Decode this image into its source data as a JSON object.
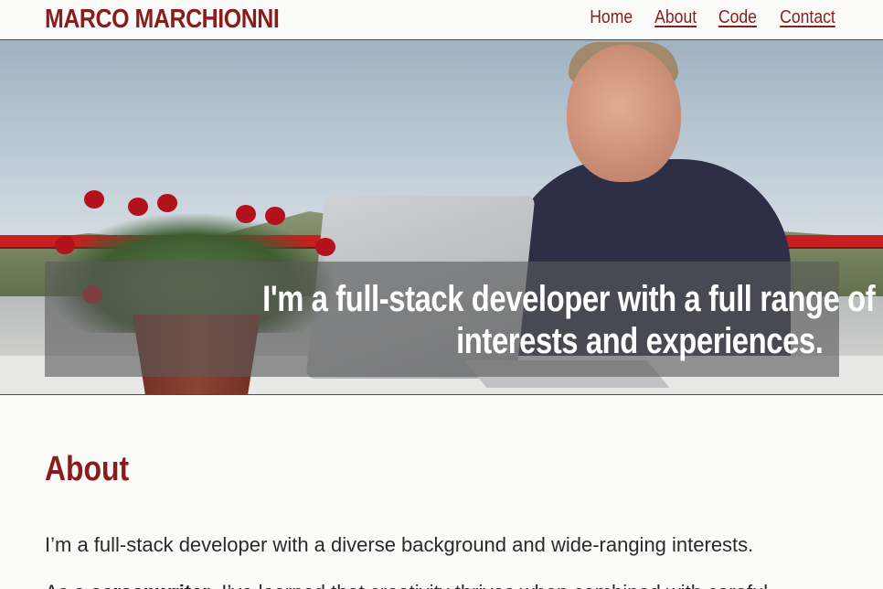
{
  "header": {
    "brand": "MARCO MARCHIONNI",
    "nav": [
      {
        "label": "Home",
        "underlined": false
      },
      {
        "label": "About",
        "underlined": true
      },
      {
        "label": "Code",
        "underlined": true
      },
      {
        "label": "Contact",
        "underlined": true
      }
    ]
  },
  "hero": {
    "caption_line1": "I'm a full-stack developer with a full range of",
    "caption_line2": "interests and experiences."
  },
  "about": {
    "title": "About",
    "intro": "I’m a full-stack developer with a diverse background and wide-ranging interests.",
    "para2_prefix": "As a ",
    "para2_bold": "screenwriter",
    "para2_suffix": ", I’ve learned that creativity thrives when combined with careful"
  },
  "colors": {
    "accent": "#8b1c1c",
    "background": "#fbfbf9"
  }
}
